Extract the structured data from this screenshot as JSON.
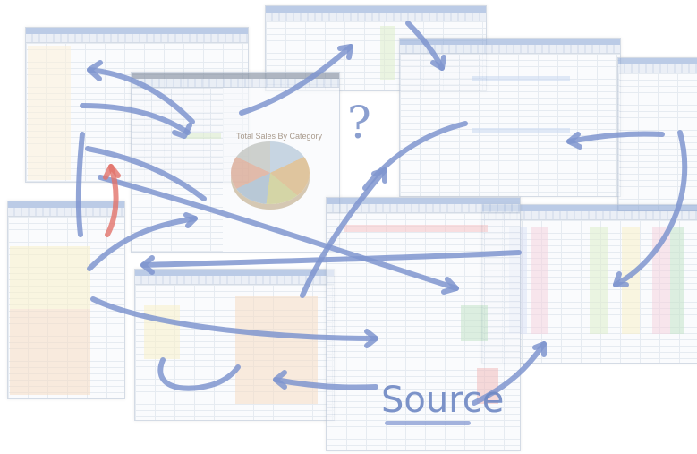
{
  "label": "Source",
  "question_mark": "?",
  "chart_title": "Total Sales By Category",
  "colors": {
    "arrow": "#7f95cf",
    "arrow_accent": "#e2736a",
    "sheet_title_bar": "#8fa9d6",
    "highlight_green": "#c9e3a8",
    "highlight_yellow": "#f5e7a4",
    "highlight_orange": "#f3c69d",
    "highlight_pink": "#efb6c9"
  },
  "icon_names": [
    "arrow-icon",
    "question-icon",
    "pie-chart-icon"
  ]
}
